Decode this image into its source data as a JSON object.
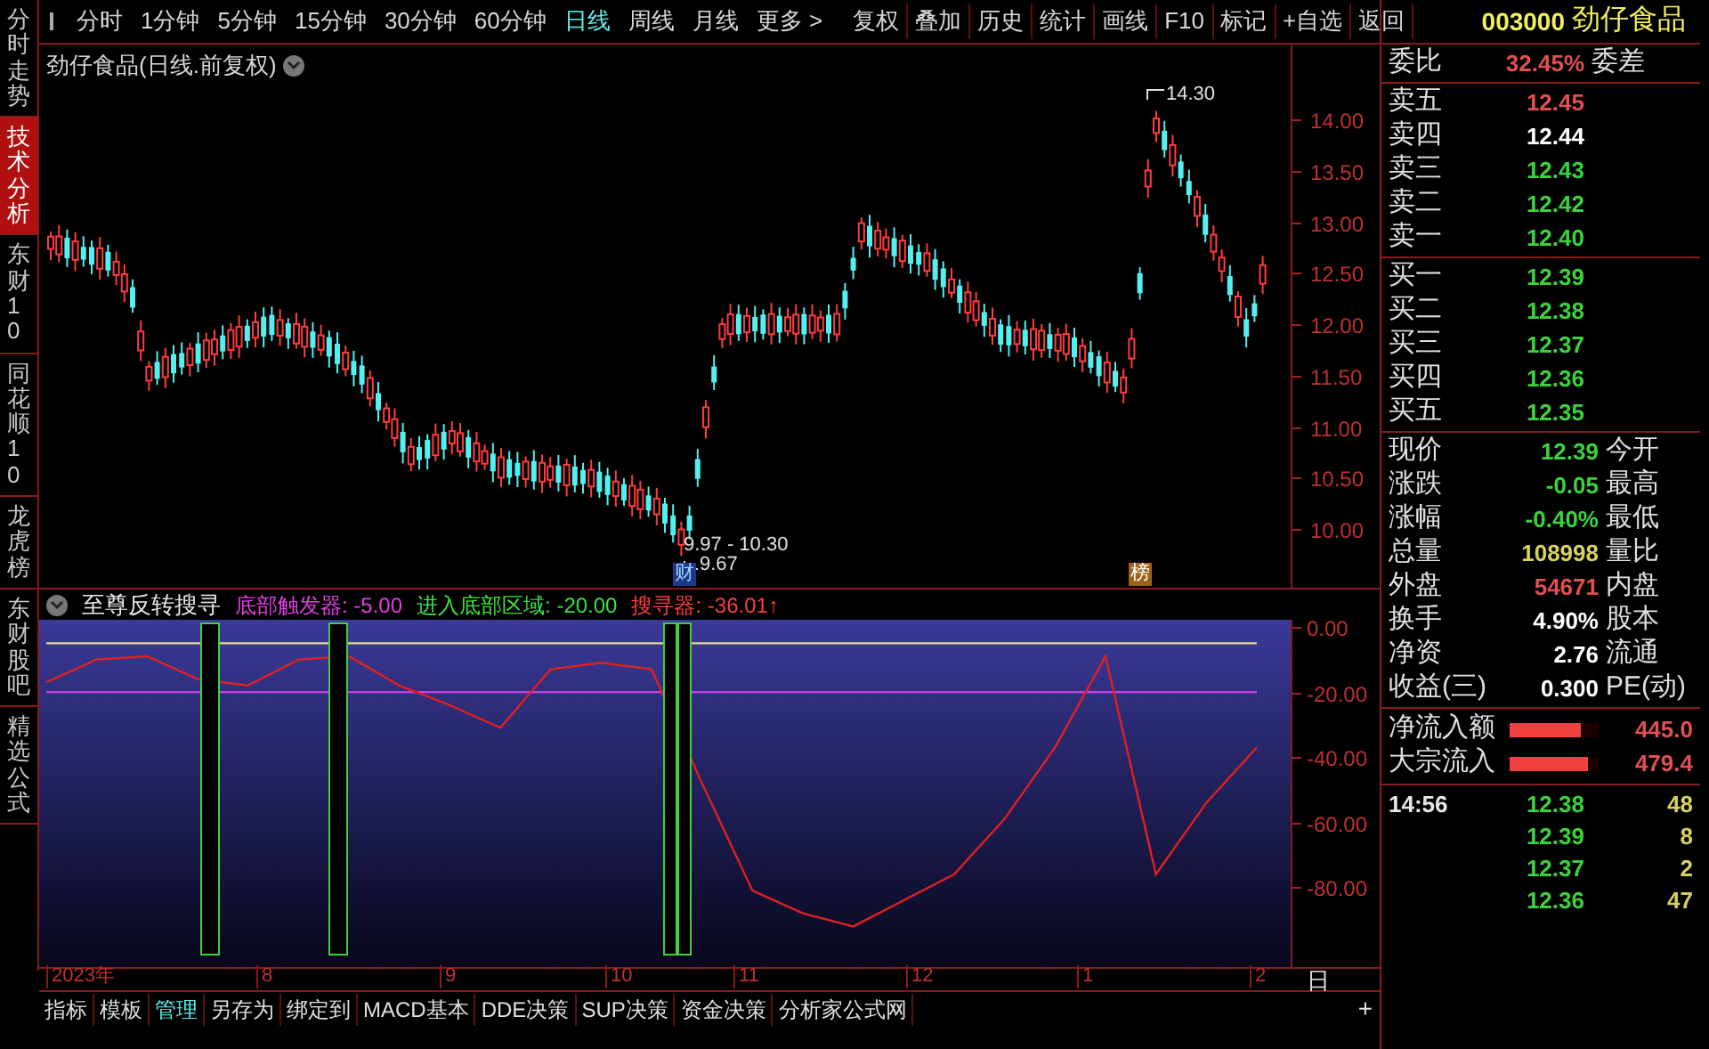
{
  "sidebar": {
    "tabs": [
      {
        "label": "分时走势",
        "selected": false
      },
      {
        "label": "技术分析",
        "selected": true
      },
      {
        "label": "东财10",
        "selected": false
      },
      {
        "label": "同花顺10",
        "selected": false
      },
      {
        "label": "龙虎榜",
        "selected": false
      },
      {
        "label": "东财股吧",
        "selected": false
      },
      {
        "label": "精选公式",
        "selected": false
      }
    ]
  },
  "toolbar": {
    "periods": [
      {
        "label": "分时",
        "selected": false
      },
      {
        "label": "1分钟",
        "selected": false
      },
      {
        "label": "5分钟",
        "selected": false
      },
      {
        "label": "15分钟",
        "selected": false
      },
      {
        "label": "30分钟",
        "selected": false
      },
      {
        "label": "60分钟",
        "selected": false
      },
      {
        "label": "日线",
        "selected": true
      },
      {
        "label": "周线",
        "selected": false
      },
      {
        "label": "月线",
        "selected": false
      },
      {
        "label": "更多 >",
        "selected": false
      }
    ],
    "actions": [
      "复权",
      "叠加",
      "历史",
      "统计",
      "画线",
      "F10",
      "标记",
      "+自选",
      "返回"
    ]
  },
  "price_chart": {
    "title": "劲仔食品(日线.前复权)",
    "yticks": [
      "14.00",
      "13.50",
      "13.00",
      "12.50",
      "12.00",
      "11.50",
      "11.00",
      "10.50",
      "10.00"
    ],
    "high_label": "14.30",
    "low_range_label": "9.97 - 10.30",
    "low_label": "9.67",
    "markers": [
      {
        "kind": "finance",
        "label": "财"
      },
      {
        "kind": "rank",
        "label": "榜"
      }
    ]
  },
  "indicator": {
    "name": "至尊反转搜寻",
    "legend": [
      {
        "label": "底部触发器: -5.00",
        "color": "#e040e0"
      },
      {
        "label": "进入底部区域: -20.00",
        "color": "#40e040"
      },
      {
        "label": "搜寻器: -36.01",
        "color": "#ff3c3c"
      }
    ],
    "trend_arrow": "↑",
    "chart_data": {
      "type": "line",
      "ylim": [
        -104.5,
        2.2
      ],
      "yticks": [
        {
          "value": 0,
          "label": "0.00"
        },
        {
          "value": -20,
          "label": "-20.00"
        },
        {
          "value": -40,
          "label": "-40.00"
        },
        {
          "value": -60,
          "label": "-60.00"
        },
        {
          "value": -80,
          "label": "-80.00"
        }
      ],
      "series": [
        {
          "color": "#e8d890",
          "values": [
            -5,
            -5,
            -5,
            -5,
            -5,
            -5,
            -5,
            -5,
            -5,
            -5,
            -5,
            -5,
            -5,
            -5,
            -5,
            -5,
            -5,
            -5,
            -5,
            -5,
            -5,
            -5,
            -5,
            -5,
            -5
          ]
        },
        {
          "color": "#c040e0",
          "values": [
            -20,
            -20,
            -20,
            -20,
            -20,
            -20,
            -20,
            -20,
            -20,
            -20,
            -20,
            -20,
            -20,
            -20,
            -20,
            -20,
            -20,
            -20,
            -20,
            -20,
            -20,
            -20,
            -20,
            -20,
            -20
          ]
        },
        {
          "color": "#e02020",
          "values": [
            -17,
            -10,
            -9,
            -16,
            -18,
            -10,
            -9,
            -18,
            -24,
            -31,
            -13,
            -11,
            -13,
            -48,
            -81,
            -88,
            -92,
            -84,
            -76,
            -59,
            -37,
            -9,
            -76,
            -54,
            -37
          ]
        }
      ]
    }
  },
  "x_axis": {
    "labels": [
      "2023年",
      "8",
      "9",
      "10",
      "11",
      "12",
      "1",
      "2"
    ]
  },
  "bottom_tabs": [
    {
      "label": "指标",
      "selected": false
    },
    {
      "label": "模板",
      "selected": false
    },
    {
      "label": "管理",
      "selected": true
    },
    {
      "label": "另存为",
      "selected": false
    },
    {
      "label": "绑定到",
      "selected": false
    },
    {
      "label": "MACD基本",
      "selected": false
    },
    {
      "label": "DDE决策",
      "selected": false
    },
    {
      "label": "SUP决策",
      "selected": false
    },
    {
      "label": "资金决策",
      "selected": false
    },
    {
      "label": "分析家公式网",
      "selected": false
    }
  ],
  "add_tab": "+",
  "period_label": "日",
  "quote_panel": {
    "code": "003000",
    "name": "劲仔食品",
    "order_ratio": {
      "label": "委比",
      "value": "32.45%",
      "diff_label": "委差"
    },
    "asks": [
      {
        "label": "卖五",
        "price": "12.45",
        "color": "#e05050"
      },
      {
        "label": "卖四",
        "price": "12.44",
        "color": "#ffffff"
      },
      {
        "label": "卖三",
        "price": "12.43",
        "color": "#3cd23c"
      },
      {
        "label": "卖二",
        "price": "12.42",
        "color": "#3cd23c"
      },
      {
        "label": "卖一",
        "price": "12.40",
        "color": "#3cd23c"
      }
    ],
    "bids": [
      {
        "label": "买一",
        "price": "12.39",
        "color": "#3cd23c"
      },
      {
        "label": "买二",
        "price": "12.38",
        "color": "#3cd23c"
      },
      {
        "label": "买三",
        "price": "12.37",
        "color": "#3cd23c"
      },
      {
        "label": "买四",
        "price": "12.36",
        "color": "#3cd23c"
      },
      {
        "label": "买五",
        "price": "12.35",
        "color": "#3cd23c"
      }
    ],
    "stats": [
      {
        "label": "现价",
        "value": "12.39",
        "label_2": "今开",
        "color": "#3cd23c"
      },
      {
        "label": "涨跌",
        "value": "-0.05",
        "label_2": "最高",
        "color": "#3cd23c"
      },
      {
        "label": "涨幅",
        "value": "-0.40%",
        "label_2": "最低",
        "color": "#3cd23c"
      },
      {
        "label": "总量",
        "value": "108998",
        "label_2": "量比",
        "color": "#d8d060"
      },
      {
        "label": "外盘",
        "value": "54671",
        "label_2": "内盘",
        "color": "#e05050"
      },
      {
        "label": "换手",
        "value": "4.90%",
        "label_2": "股本",
        "color": "#ffffff"
      },
      {
        "label": "净资",
        "value": "2.76",
        "label_2": "流通",
        "color": "#ffffff"
      },
      {
        "label": "收益(三)",
        "value": "0.300",
        "label_2": "PE(动)",
        "color": "#ffffff"
      }
    ],
    "flows": [
      {
        "label": "净流入额",
        "level": 0.8,
        "value": "445.0"
      },
      {
        "label": "大宗流入",
        "level": 0.87,
        "value": "479.4"
      }
    ],
    "trades": [
      {
        "time": "14:56",
        "price": "12.38",
        "volume": "48",
        "color": "#d8d060"
      },
      {
        "price": "12.39",
        "volume": "8",
        "color": "#d8d060"
      },
      {
        "price": "12.37",
        "volume": "2",
        "color": "#d8d060"
      },
      {
        "price": "12.36",
        "volume": "47",
        "color": "#d8d060"
      }
    ]
  }
}
